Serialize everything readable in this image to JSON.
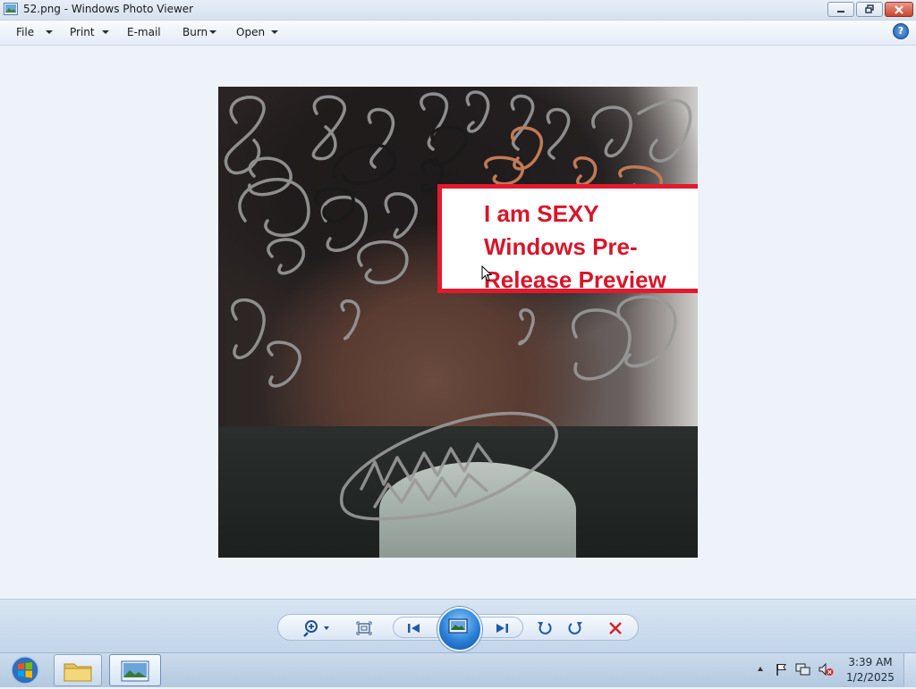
{
  "window": {
    "title": "52.png - Windows Photo Viewer"
  },
  "menu": {
    "items": [
      "File",
      "Print",
      "E-mail",
      "Burn",
      "Open"
    ],
    "help": "?"
  },
  "photo": {
    "caption": "I am SEXY\nWindows Pre-\nRelease Preview",
    "border_color": "#e4192d",
    "text_color": "#d8162a"
  },
  "controls": {
    "zoom": "zoom-icon",
    "actual_size": "actual-size-icon",
    "previous": "previous-icon",
    "slideshow": "slideshow-icon",
    "next": "next-icon",
    "rotate_ccw": "rotate-counterclockwise-icon",
    "rotate_cw": "rotate-clockwise-icon",
    "delete": "delete-icon"
  },
  "taskbar": {
    "time": "3:39 AM",
    "date": "1/2/2025"
  }
}
